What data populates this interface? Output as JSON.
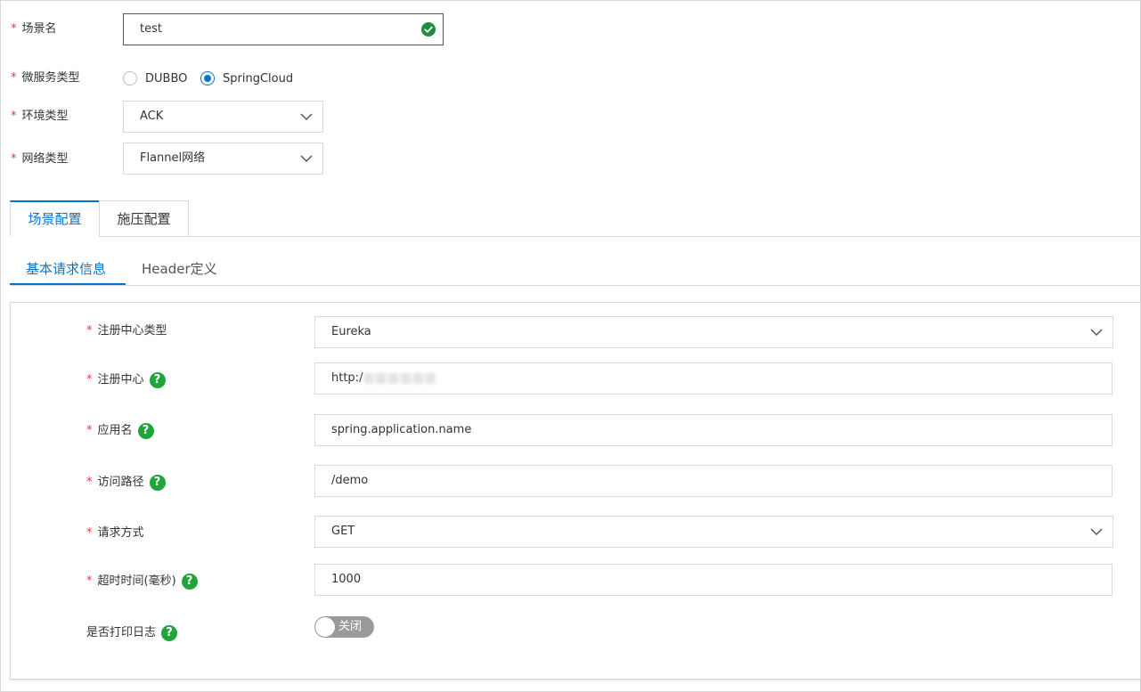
{
  "scene_name": {
    "label": "场景名",
    "value": "test"
  },
  "microservice_type": {
    "label": "微服务类型",
    "options": [
      "DUBBO",
      "SpringCloud"
    ],
    "selected": "SpringCloud"
  },
  "env_type": {
    "label": "环境类型",
    "value": "ACK"
  },
  "network_type": {
    "label": "网络类型",
    "value": "Flannel网络"
  },
  "tabs": [
    {
      "label": "场景配置",
      "active": true
    },
    {
      "label": "施压配置",
      "active": false
    }
  ],
  "subtabs": [
    {
      "label": "基本请求信息",
      "active": true
    },
    {
      "label": "Header定义",
      "active": false
    }
  ],
  "form": {
    "registry_type": {
      "label": "注册中心类型",
      "value": "Eureka"
    },
    "registry": {
      "label": "注册中心",
      "value": "http:/"
    },
    "app_name": {
      "label": "应用名",
      "value": "spring.application.name"
    },
    "access_path": {
      "label": "访问路径",
      "value": "/demo"
    },
    "request_method": {
      "label": "请求方式",
      "value": "GET"
    },
    "timeout": {
      "label": "超时时间(毫秒)",
      "value": "1000"
    },
    "print_log": {
      "label": "是否打印日志",
      "state": "关闭"
    }
  },
  "icons": {
    "help": "?",
    "success": "check-circle-icon",
    "dropdown": "chevron-down-icon"
  },
  "colors": {
    "primary": "#0b73c9",
    "required": "#e4393c",
    "help": "#20a53a",
    "success": "#1e8e3e"
  }
}
